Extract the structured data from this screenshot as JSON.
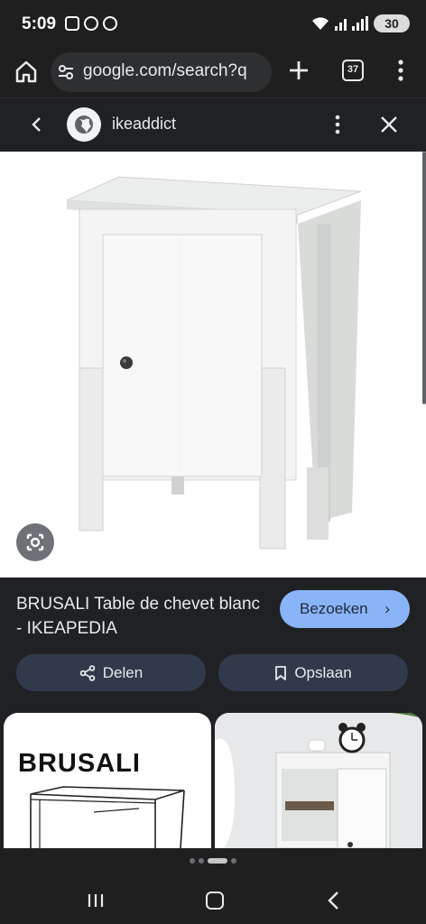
{
  "status_bar": {
    "time": "5:09",
    "battery": "30"
  },
  "toolbar": {
    "url": "google.com/search?q",
    "tab_count": "37"
  },
  "source": {
    "name": "ikeaddict"
  },
  "result": {
    "title": "BRUSALI Table de chevet blanc - IKEAPEDIA",
    "visit_label": "Bezoeken",
    "visit_chevron": "›",
    "share_label": "Delen",
    "save_label": "Opslaan"
  },
  "related": [
    {
      "label": "BRUSALI"
    },
    {
      "label": ""
    }
  ],
  "icons": {
    "home": "home-icon",
    "tune": "tune-icon",
    "plus": "plus-icon",
    "tabs": "tab-switcher-icon",
    "menu": "more-vert-icon",
    "back": "chevron-left-icon",
    "close": "close-icon",
    "lens": "google-lens-icon",
    "share": "share-icon",
    "bookmark": "bookmark-icon"
  },
  "colors": {
    "accent": "#8ab4f8",
    "background": "#202124",
    "secondary_button": "#303a4a"
  }
}
